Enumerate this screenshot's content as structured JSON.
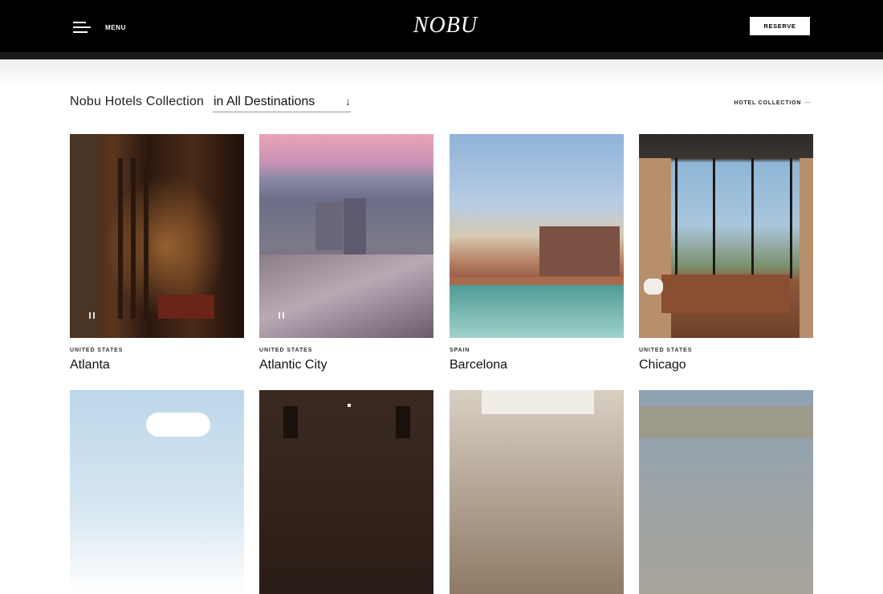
{
  "header": {
    "menu_label": "MENU",
    "logo_text": "NOBU",
    "reserve_label": "RESERVE"
  },
  "filter": {
    "title": "Nobu Hotels Collection",
    "destination_value": "in All Destinations",
    "arrow_glyph": "↓",
    "collection_link": "HOTEL COLLECTION",
    "collection_link_dash": "—"
  },
  "hotels": [
    {
      "country": "UNITED STATES",
      "city": "Atlanta",
      "has_video": true
    },
    {
      "country": "UNITED STATES",
      "city": "Atlantic City",
      "has_video": true
    },
    {
      "country": "SPAIN",
      "city": "Barcelona",
      "has_video": false
    },
    {
      "country": "UNITED STATES",
      "city": "Chicago",
      "has_video": false
    }
  ],
  "icons": {
    "menu": "hamburger-icon",
    "select_arrow": "arrow-down-icon",
    "pause": "pause-icon"
  },
  "colors": {
    "header_bg": "#000000",
    "page_bg": "#ffffff",
    "text": "#111111"
  }
}
